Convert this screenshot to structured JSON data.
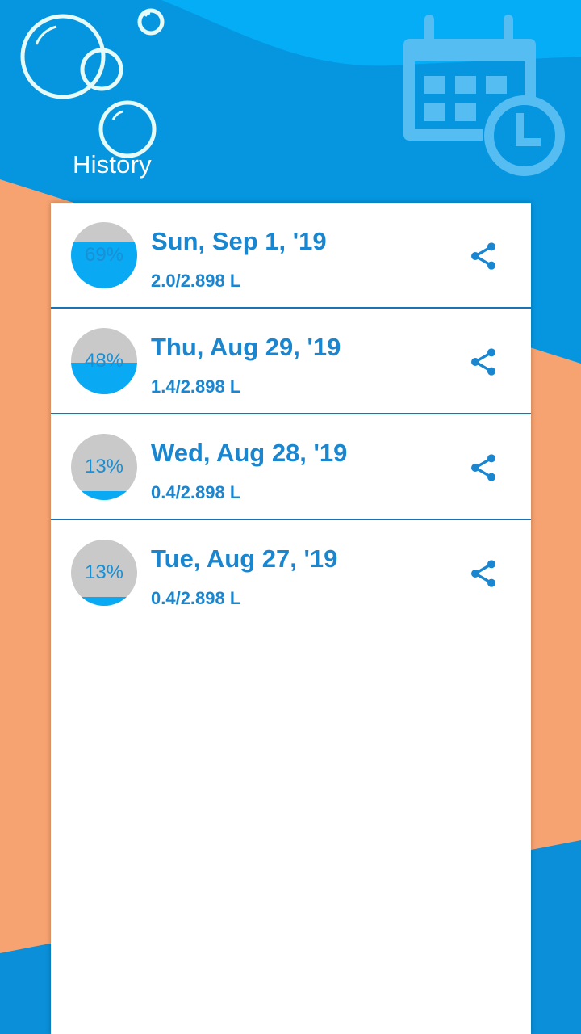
{
  "header": {
    "title": "History",
    "icon": "calendar-clock-icon"
  },
  "colors": {
    "top_blue": "#039be5",
    "light_blue": "#05acf6",
    "orange": "#f6a271",
    "accent": "#1a86d0",
    "gauge_fill": "#09a9f4",
    "gauge_empty": "#c9c9c9"
  },
  "history": [
    {
      "date": "Sun, Sep 1, '19",
      "amount": "2.0/2.898 L",
      "percent_label": "69%",
      "fill_fraction": 0.69
    },
    {
      "date": "Thu, Aug 29, '19",
      "amount": "1.4/2.898 L",
      "percent_label": "48%",
      "fill_fraction": 0.48
    },
    {
      "date": "Wed, Aug 28, '19",
      "amount": "0.4/2.898 L",
      "percent_label": "13%",
      "fill_fraction": 0.13
    },
    {
      "date": "Tue, Aug 27, '19",
      "amount": "0.4/2.898 L",
      "percent_label": "13%",
      "fill_fraction": 0.13
    }
  ]
}
